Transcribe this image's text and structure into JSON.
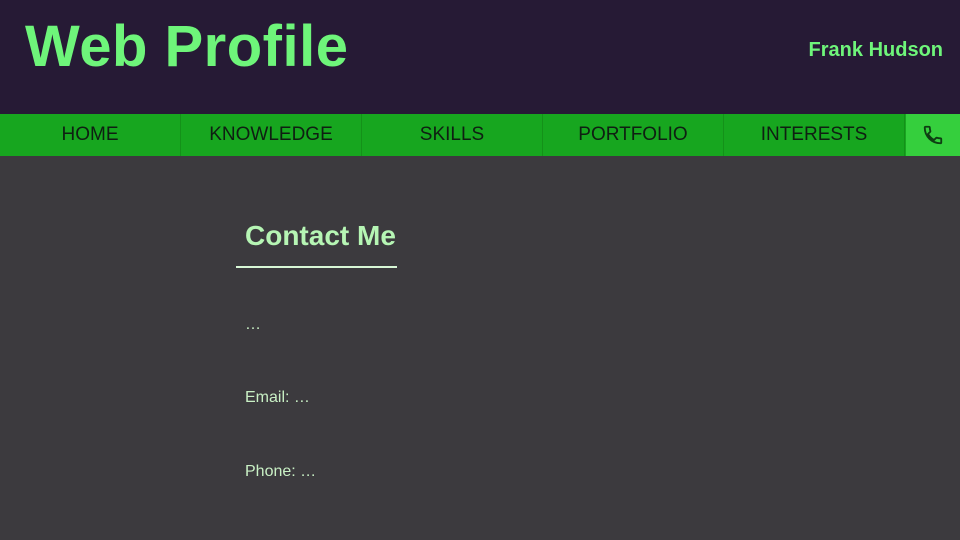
{
  "header": {
    "title": "Web Profile",
    "user_name": "Frank Hudson"
  },
  "nav": {
    "items": [
      {
        "label": "HOME"
      },
      {
        "label": "KNOWLEDGE"
      },
      {
        "label": "SKILLS"
      },
      {
        "label": "PORTFOLIO"
      },
      {
        "label": "INTERESTS"
      }
    ],
    "phone_icon": "phone-icon"
  },
  "contact": {
    "heading": "Contact Me",
    "intro": "…",
    "email_text": "Email: …",
    "phone_text": "Phone: …"
  },
  "colors": {
    "header_bg": "#261a35",
    "accent_green": "#6ef57a",
    "nav_bg": "#17a61f",
    "nav_active_bg": "#35cf3d",
    "content_bg": "#3c3a3e",
    "content_text": "#c9f0c5"
  }
}
